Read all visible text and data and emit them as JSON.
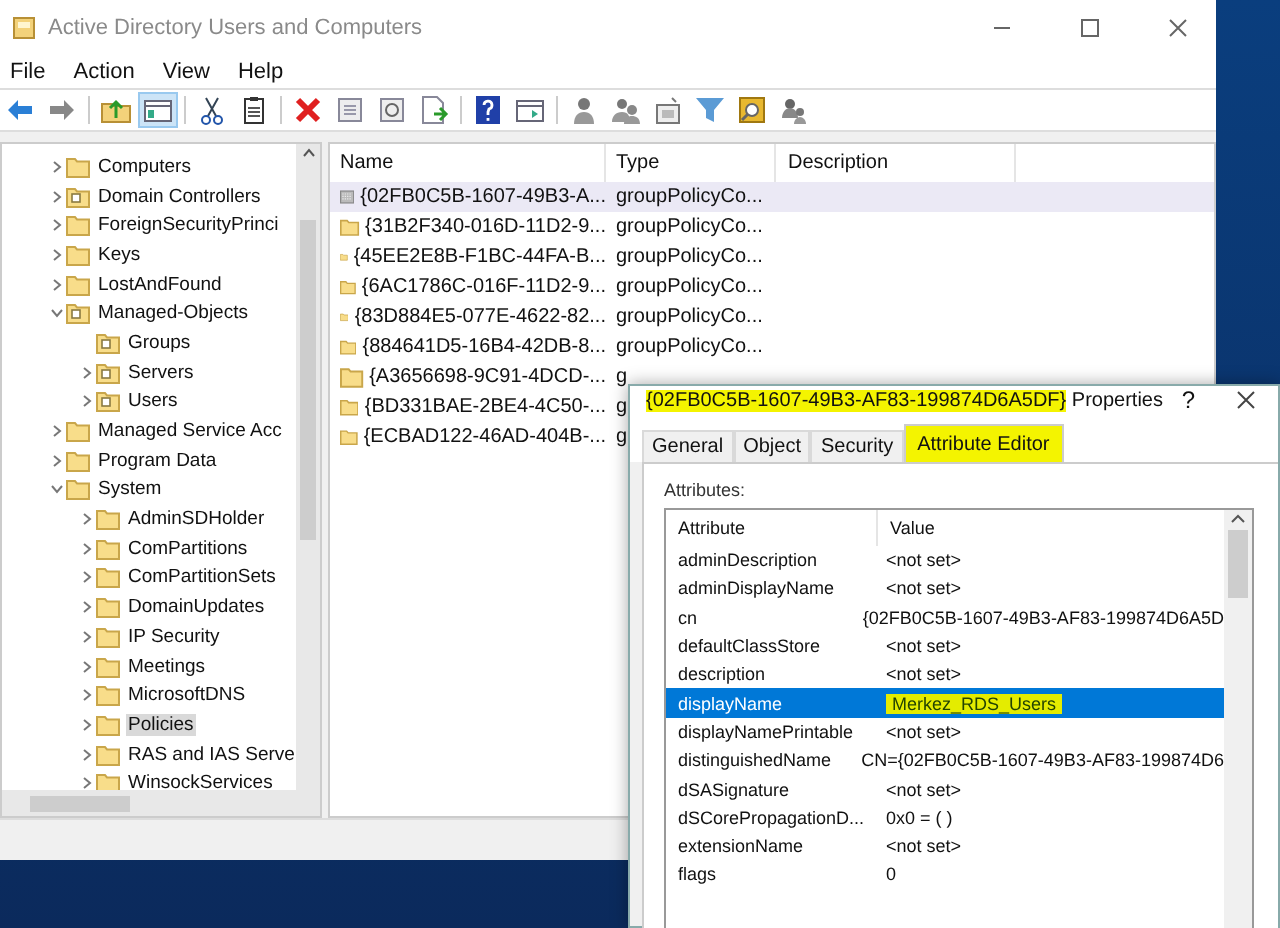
{
  "window": {
    "title": "Active Directory Users and Computers"
  },
  "menu": [
    "File",
    "Action",
    "View",
    "Help"
  ],
  "tree": [
    {
      "label": "Computers",
      "kind": "container",
      "expandable": true,
      "expanded": false,
      "selected": false
    },
    {
      "label": "Domain Controllers",
      "kind": "ou",
      "expandable": true,
      "expanded": false,
      "selected": false
    },
    {
      "label": "ForeignSecurityPrinci",
      "kind": "container",
      "expandable": true,
      "expanded": false,
      "selected": false
    },
    {
      "label": "Keys",
      "kind": "container",
      "expandable": true,
      "expanded": false,
      "selected": false
    },
    {
      "label": "LostAndFound",
      "kind": "container",
      "expandable": true,
      "expanded": false,
      "selected": false
    },
    {
      "label": "Managed-Objects",
      "kind": "ou",
      "expandable": true,
      "expanded": true,
      "selected": false,
      "children": [
        {
          "label": "Groups",
          "kind": "ou",
          "expandable": false,
          "selected": false
        },
        {
          "label": "Servers",
          "kind": "ou",
          "expandable": true,
          "expanded": false,
          "selected": false
        },
        {
          "label": "Users",
          "kind": "ou",
          "expandable": true,
          "expanded": false,
          "selected": false
        }
      ]
    },
    {
      "label": "Managed Service Acc",
      "kind": "container",
      "expandable": true,
      "expanded": false,
      "selected": false
    },
    {
      "label": "Program Data",
      "kind": "container",
      "expandable": true,
      "expanded": false,
      "selected": false
    },
    {
      "label": "System",
      "kind": "container",
      "expandable": true,
      "expanded": true,
      "selected": false,
      "children": [
        {
          "label": "AdminSDHolder",
          "kind": "container",
          "expandable": true,
          "expanded": false,
          "selected": false
        },
        {
          "label": "ComPartitions",
          "kind": "container",
          "expandable": true,
          "expanded": false,
          "selected": false
        },
        {
          "label": "ComPartitionSets",
          "kind": "container",
          "expandable": true,
          "expanded": false,
          "selected": false
        },
        {
          "label": "DomainUpdates",
          "kind": "container",
          "expandable": true,
          "expanded": false,
          "selected": false
        },
        {
          "label": "IP Security",
          "kind": "container",
          "expandable": true,
          "expanded": false,
          "selected": false
        },
        {
          "label": "Meetings",
          "kind": "container",
          "expandable": true,
          "expanded": false,
          "selected": false
        },
        {
          "label": "MicrosoftDNS",
          "kind": "container",
          "expandable": true,
          "expanded": false,
          "selected": false
        },
        {
          "label": "Policies",
          "kind": "container",
          "expandable": true,
          "expanded": false,
          "selected": true
        },
        {
          "label": "RAS and IAS Serve",
          "kind": "container",
          "expandable": true,
          "expanded": false,
          "selected": false
        },
        {
          "label": "WinsockServices",
          "kind": "container",
          "expandable": true,
          "expanded": false,
          "selected": false
        }
      ]
    }
  ],
  "list": {
    "columns": [
      "Name",
      "Type",
      "Description"
    ],
    "rows": [
      {
        "name": "{02FB0C5B-1607-49B3-A...",
        "type": "groupPolicyCo...",
        "kind": "gpo",
        "selected": true
      },
      {
        "name": "{31B2F340-016D-11D2-9...",
        "type": "groupPolicyCo...",
        "kind": "folder",
        "selected": false
      },
      {
        "name": "{45EE2E8B-F1BC-44FA-B...",
        "type": "groupPolicyCo...",
        "kind": "folder",
        "selected": false
      },
      {
        "name": "{6AC1786C-016F-11D2-9...",
        "type": "groupPolicyCo...",
        "kind": "folder",
        "selected": false
      },
      {
        "name": "{83D884E5-077E-4622-82...",
        "type": "groupPolicyCo...",
        "kind": "folder",
        "selected": false
      },
      {
        "name": "{884641D5-16B4-42DB-8...",
        "type": "groupPolicyCo...",
        "kind": "folder",
        "selected": false
      },
      {
        "name": "{A3656698-9C91-4DCD-...",
        "type": "g",
        "kind": "folder",
        "selected": false
      },
      {
        "name": "{BD331BAE-2BE4-4C50-...",
        "type": "g",
        "kind": "folder",
        "selected": false
      },
      {
        "name": "{ECBAD122-46AD-404B-...",
        "type": "g",
        "kind": "folder",
        "selected": false
      }
    ]
  },
  "dialog": {
    "title_parts": [
      {
        "text": "{02FB0C5B-1607-49B3-AF83-199874D6A5DF}",
        "highlighted": true
      },
      {
        "text": " Properties",
        "highlighted": false
      }
    ],
    "help": "?",
    "tabs": [
      {
        "label": "General",
        "selected": false,
        "highlighted": false
      },
      {
        "label": "Object",
        "selected": false,
        "highlighted": false
      },
      {
        "label": "Security",
        "selected": false,
        "highlighted": false
      },
      {
        "label": "Attribute Editor",
        "selected": true,
        "highlighted": true
      }
    ],
    "attributes_label": "Attributes:",
    "columns": [
      "Attribute",
      "Value"
    ],
    "rows": [
      {
        "attribute": "adminDescription",
        "value": "<not set>",
        "selected": false,
        "highlighted": false
      },
      {
        "attribute": "adminDisplayName",
        "value": "<not set>",
        "selected": false,
        "highlighted": false
      },
      {
        "attribute": "cn",
        "value": "{02FB0C5B-1607-49B3-AF83-199874D6A5D",
        "selected": false,
        "highlighted": false
      },
      {
        "attribute": "defaultClassStore",
        "value": "<not set>",
        "selected": false,
        "highlighted": false
      },
      {
        "attribute": "description",
        "value": "<not set>",
        "selected": false,
        "highlighted": false
      },
      {
        "attribute": "displayName",
        "value": "Merkez_RDS_Users",
        "selected": true,
        "highlighted": true
      },
      {
        "attribute": "displayNamePrintable",
        "value": "<not set>",
        "selected": false,
        "highlighted": false
      },
      {
        "attribute": "distinguishedName",
        "value": "CN={02FB0C5B-1607-49B3-AF83-199874D6",
        "selected": false,
        "highlighted": false
      },
      {
        "attribute": "dSASignature",
        "value": "<not set>",
        "selected": false,
        "highlighted": false
      },
      {
        "attribute": "dSCorePropagationD...",
        "value": "0x0 = ( )",
        "selected": false,
        "highlighted": false
      },
      {
        "attribute": "extensionName",
        "value": "<not set>",
        "selected": false,
        "highlighted": false
      },
      {
        "attribute": "flags",
        "value": "0",
        "selected": false,
        "highlighted": false
      }
    ]
  }
}
